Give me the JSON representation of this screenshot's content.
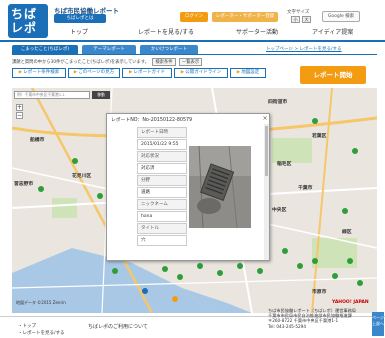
{
  "header": {
    "logo_line1": "ちば",
    "logo_line2": "レポ",
    "site_title": "ちば市民協働レポート",
    "site_subtitle": "ちばレポとは",
    "login_label": "ログイン",
    "register_label": "レポーター・サポーター登録",
    "fontsize_label": "文字サイズ",
    "fontsize_small": "小",
    "fontsize_large": "大",
    "search_label": "Google 検索"
  },
  "global_nav": [
    "トップ",
    "レポートを見る/する",
    "サポーター活動",
    "アイディア提案"
  ],
  "tabs": [
    "こまったこと(ちばレポ)",
    "テーマレポート",
    "かいけつレポート"
  ],
  "top_links": "トップページ > レポートを見る/する",
  "description": {
    "text": "課題と質問の中から30件がこまったこと(ちばレポ)を表示しています。",
    "chip1": "検索条件",
    "chip2": "一覧表示"
  },
  "sub_buttons": [
    "レポート条件検索",
    "このページの見方",
    "レポートガイド",
    "公開ガイドライン",
    "地図設定"
  ],
  "report_start_label": "レポート開始",
  "map": {
    "search_placeholder": "例）千葉市中央区千葉港1-1",
    "search_button": "移動",
    "places": [
      "四街道市",
      "習志野市",
      "船橋市",
      "千葉市",
      "花見川区",
      "稲毛区",
      "若葉区",
      "中央区",
      "美浜区",
      "緑区",
      "市原市"
    ],
    "copyright": "地図データ ©2015 Zenrin",
    "brand": "YAHOO! JAPAN"
  },
  "popup": {
    "title": "レポートNO：No-20150122-80579",
    "fields": [
      {
        "label": "レポート日時",
        "value": "2015/01/22 9:55"
      },
      {
        "label": "対応状況",
        "value": "対応済"
      },
      {
        "label": "分野",
        "value": "道路"
      },
      {
        "label": "ニックネーム",
        "value": "hana"
      },
      {
        "label": "タイトル",
        "value": "穴"
      }
    ]
  },
  "footer": {
    "links": [
      "トップ",
      "レポートを見る/する"
    ],
    "about": "ちばレポのご利用について",
    "org_lines": [
      "ちば市民協働レポート（ちばレポ）運営事務局",
      "千葉市市民局市民自治推進部市民協働推進課",
      "〒260-8722 千葉市中央区千葉港1-1",
      "Tel: 043-245-5294"
    ],
    "page_top": "ページ上部へ"
  },
  "colors": {
    "brand_blue": "#1a6fb6",
    "accent_orange": "#f39c12",
    "marker_green": "#2e9e3b",
    "map_base": "#eae6df"
  }
}
